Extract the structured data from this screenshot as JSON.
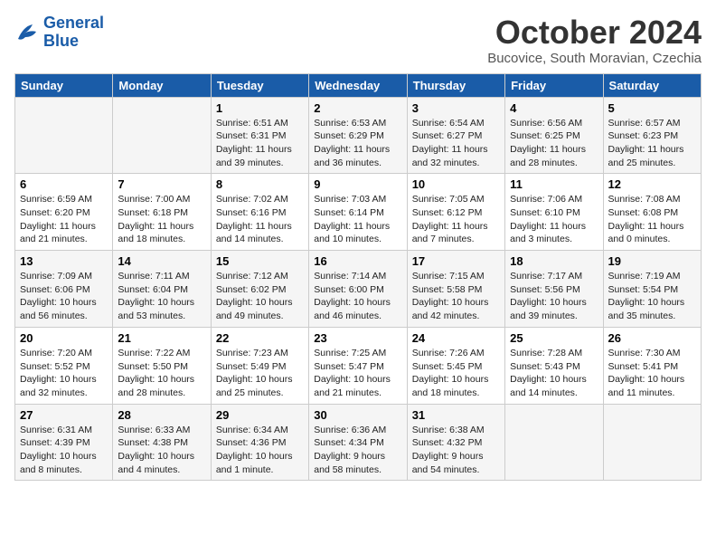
{
  "header": {
    "logo_line1": "General",
    "logo_line2": "Blue",
    "month": "October 2024",
    "location": "Bucovice, South Moravian, Czechia"
  },
  "weekdays": [
    "Sunday",
    "Monday",
    "Tuesday",
    "Wednesday",
    "Thursday",
    "Friday",
    "Saturday"
  ],
  "weeks": [
    [
      {
        "day": "",
        "info": ""
      },
      {
        "day": "",
        "info": ""
      },
      {
        "day": "1",
        "info": "Sunrise: 6:51 AM\nSunset: 6:31 PM\nDaylight: 11 hours and 39 minutes."
      },
      {
        "day": "2",
        "info": "Sunrise: 6:53 AM\nSunset: 6:29 PM\nDaylight: 11 hours and 36 minutes."
      },
      {
        "day": "3",
        "info": "Sunrise: 6:54 AM\nSunset: 6:27 PM\nDaylight: 11 hours and 32 minutes."
      },
      {
        "day": "4",
        "info": "Sunrise: 6:56 AM\nSunset: 6:25 PM\nDaylight: 11 hours and 28 minutes."
      },
      {
        "day": "5",
        "info": "Sunrise: 6:57 AM\nSunset: 6:23 PM\nDaylight: 11 hours and 25 minutes."
      }
    ],
    [
      {
        "day": "6",
        "info": "Sunrise: 6:59 AM\nSunset: 6:20 PM\nDaylight: 11 hours and 21 minutes."
      },
      {
        "day": "7",
        "info": "Sunrise: 7:00 AM\nSunset: 6:18 PM\nDaylight: 11 hours and 18 minutes."
      },
      {
        "day": "8",
        "info": "Sunrise: 7:02 AM\nSunset: 6:16 PM\nDaylight: 11 hours and 14 minutes."
      },
      {
        "day": "9",
        "info": "Sunrise: 7:03 AM\nSunset: 6:14 PM\nDaylight: 11 hours and 10 minutes."
      },
      {
        "day": "10",
        "info": "Sunrise: 7:05 AM\nSunset: 6:12 PM\nDaylight: 11 hours and 7 minutes."
      },
      {
        "day": "11",
        "info": "Sunrise: 7:06 AM\nSunset: 6:10 PM\nDaylight: 11 hours and 3 minutes."
      },
      {
        "day": "12",
        "info": "Sunrise: 7:08 AM\nSunset: 6:08 PM\nDaylight: 11 hours and 0 minutes."
      }
    ],
    [
      {
        "day": "13",
        "info": "Sunrise: 7:09 AM\nSunset: 6:06 PM\nDaylight: 10 hours and 56 minutes."
      },
      {
        "day": "14",
        "info": "Sunrise: 7:11 AM\nSunset: 6:04 PM\nDaylight: 10 hours and 53 minutes."
      },
      {
        "day": "15",
        "info": "Sunrise: 7:12 AM\nSunset: 6:02 PM\nDaylight: 10 hours and 49 minutes."
      },
      {
        "day": "16",
        "info": "Sunrise: 7:14 AM\nSunset: 6:00 PM\nDaylight: 10 hours and 46 minutes."
      },
      {
        "day": "17",
        "info": "Sunrise: 7:15 AM\nSunset: 5:58 PM\nDaylight: 10 hours and 42 minutes."
      },
      {
        "day": "18",
        "info": "Sunrise: 7:17 AM\nSunset: 5:56 PM\nDaylight: 10 hours and 39 minutes."
      },
      {
        "day": "19",
        "info": "Sunrise: 7:19 AM\nSunset: 5:54 PM\nDaylight: 10 hours and 35 minutes."
      }
    ],
    [
      {
        "day": "20",
        "info": "Sunrise: 7:20 AM\nSunset: 5:52 PM\nDaylight: 10 hours and 32 minutes."
      },
      {
        "day": "21",
        "info": "Sunrise: 7:22 AM\nSunset: 5:50 PM\nDaylight: 10 hours and 28 minutes."
      },
      {
        "day": "22",
        "info": "Sunrise: 7:23 AM\nSunset: 5:49 PM\nDaylight: 10 hours and 25 minutes."
      },
      {
        "day": "23",
        "info": "Sunrise: 7:25 AM\nSunset: 5:47 PM\nDaylight: 10 hours and 21 minutes."
      },
      {
        "day": "24",
        "info": "Sunrise: 7:26 AM\nSunset: 5:45 PM\nDaylight: 10 hours and 18 minutes."
      },
      {
        "day": "25",
        "info": "Sunrise: 7:28 AM\nSunset: 5:43 PM\nDaylight: 10 hours and 14 minutes."
      },
      {
        "day": "26",
        "info": "Sunrise: 7:30 AM\nSunset: 5:41 PM\nDaylight: 10 hours and 11 minutes."
      }
    ],
    [
      {
        "day": "27",
        "info": "Sunrise: 6:31 AM\nSunset: 4:39 PM\nDaylight: 10 hours and 8 minutes."
      },
      {
        "day": "28",
        "info": "Sunrise: 6:33 AM\nSunset: 4:38 PM\nDaylight: 10 hours and 4 minutes."
      },
      {
        "day": "29",
        "info": "Sunrise: 6:34 AM\nSunset: 4:36 PM\nDaylight: 10 hours and 1 minute."
      },
      {
        "day": "30",
        "info": "Sunrise: 6:36 AM\nSunset: 4:34 PM\nDaylight: 9 hours and 58 minutes."
      },
      {
        "day": "31",
        "info": "Sunrise: 6:38 AM\nSunset: 4:32 PM\nDaylight: 9 hours and 54 minutes."
      },
      {
        "day": "",
        "info": ""
      },
      {
        "day": "",
        "info": ""
      }
    ]
  ]
}
